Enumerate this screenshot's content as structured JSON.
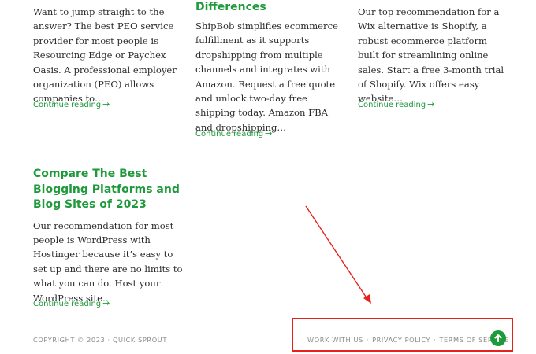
{
  "cards": [
    {
      "title": "",
      "excerpt": "Want to jump straight to the answer? The best PEO service provider for most people is Resourcing Edge or Paychex Oasis. A professional employer organization (PEO) allows companies to…",
      "more": "Continue reading"
    },
    {
      "title": "Differences",
      "excerpt": "ShipBob simplifies ecommerce fulfillment as it supports dropshipping from multiple channels and integrates with Amazon. Request a free quote and unlock two-day free shipping today. Amazon FBA and dropshipping…",
      "more": "Continue reading"
    },
    {
      "title": "",
      "excerpt": "Our top recommendation for a Wix alternative is Shopify, a robust ecommerce platform built for streamlining online sales. Start a free 3-month trial of Shopify. Wix offers easy website…",
      "more": "Continue reading"
    },
    {
      "title": "Compare The Best Blogging Platforms and Blog Sites of 2023",
      "excerpt": "Our recommendation for most people is WordPress with Hostinger because it’s easy to set up and there are no limits to what you can do. Host your WordPress site…",
      "more": "Continue reading"
    }
  ],
  "footer": {
    "copyright": "COPYRIGHT © 2023 · QUICK SPROUT",
    "links": [
      "WORK WITH US",
      "PRIVACY POLICY",
      "TERMS OF SERVICE"
    ],
    "separator": "·"
  },
  "icons": {
    "continue": "arrow-right-icon",
    "scroll": "arrow-up-icon"
  },
  "colors": {
    "accent": "#1e9a3b",
    "annotation": "#e8201c",
    "footer_text": "#8a8a8a"
  }
}
